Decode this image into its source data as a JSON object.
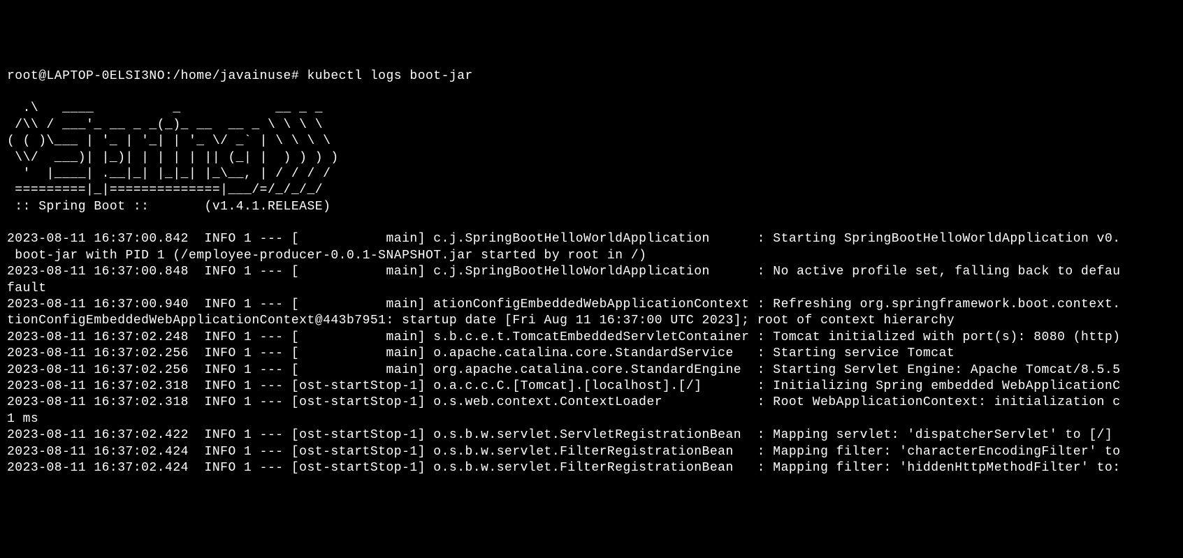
{
  "prompt": "root@LAPTOP-0ELSI3NO:/home/javainuse# kubectl logs boot-jar",
  "banner_line1": "  .\\   ____          _            __ _ _",
  "banner_line2": " /\\\\ / ___'_ __ _ _(_)_ __  __ _ \\ \\ \\ \\",
  "banner_line3": "( ( )\\___ | '_ | '_| | '_ \\/ _` | \\ \\ \\ \\",
  "banner_line4": " \\\\/  ___)| |_)| | | | | || (_| |  ) ) ) )",
  "banner_line5": "  '  |____| .__|_| |_|_| |_\\__, | / / / /",
  "banner_line6": " =========|_|==============|___/=/_/_/_/",
  "banner_line7": " :: Spring Boot ::       (v1.4.1.RELEASE)",
  "log1": "2023-08-11 16:37:00.842  INFO 1 --- [           main] c.j.SpringBootHelloWorldApplication      : Starting SpringBootHelloWorldApplication v0.",
  "log1b": " boot-jar with PID 1 (/employee-producer-0.0.1-SNAPSHOT.jar started by root in /)",
  "log2": "2023-08-11 16:37:00.848  INFO 1 --- [           main] c.j.SpringBootHelloWorldApplication      : No active profile set, falling back to defau",
  "log2b": "fault",
  "log3": "2023-08-11 16:37:00.940  INFO 1 --- [           main] ationConfigEmbeddedWebApplicationContext : Refreshing org.springframework.boot.context.",
  "log3b": "tionConfigEmbeddedWebApplicationContext@443b7951: startup date [Fri Aug 11 16:37:00 UTC 2023]; root of context hierarchy",
  "log4": "2023-08-11 16:37:02.248  INFO 1 --- [           main] s.b.c.e.t.TomcatEmbeddedServletContainer : Tomcat initialized with port(s): 8080 (http)",
  "log5": "2023-08-11 16:37:02.256  INFO 1 --- [           main] o.apache.catalina.core.StandardService   : Starting service Tomcat",
  "log6": "2023-08-11 16:37:02.256  INFO 1 --- [           main] org.apache.catalina.core.StandardEngine  : Starting Servlet Engine: Apache Tomcat/8.5.5",
  "log7": "2023-08-11 16:37:02.318  INFO 1 --- [ost-startStop-1] o.a.c.c.C.[Tomcat].[localhost].[/]       : Initializing Spring embedded WebApplicationC",
  "log8": "2023-08-11 16:37:02.318  INFO 1 --- [ost-startStop-1] o.s.web.context.ContextLoader            : Root WebApplicationContext: initialization c",
  "log8b": "1 ms",
  "log9": "2023-08-11 16:37:02.422  INFO 1 --- [ost-startStop-1] o.s.b.w.servlet.ServletRegistrationBean  : Mapping servlet: 'dispatcherServlet' to [/]",
  "log10": "2023-08-11 16:37:02.424  INFO 1 --- [ost-startStop-1] o.s.b.w.servlet.FilterRegistrationBean   : Mapping filter: 'characterEncodingFilter' to",
  "log11": "2023-08-11 16:37:02.424  INFO 1 --- [ost-startStop-1] o.s.b.w.servlet.FilterRegistrationBean   : Mapping filter: 'hiddenHttpMethodFilter' to:"
}
